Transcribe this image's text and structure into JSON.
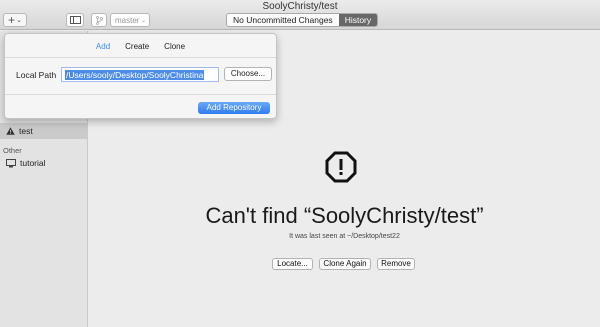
{
  "window": {
    "title": "SoolyChristy/test"
  },
  "toolbar": {
    "add_label": "+",
    "add_chevron": "⌄",
    "branch_label": "master",
    "branch_chevron": "⌄",
    "segments": [
      {
        "label": "No Uncommitted Changes",
        "active": false
      },
      {
        "label": "History",
        "active": true
      }
    ]
  },
  "popover": {
    "tabs": [
      {
        "label": "Add",
        "active": true
      },
      {
        "label": "Create",
        "active": false
      },
      {
        "label": "Clone",
        "active": false
      }
    ],
    "local_path_label": "Local Path",
    "local_path_value": "/Users/sooly/Desktop/SoolyChristina",
    "choose_label": "Choose...",
    "add_repository_label": "Add Repository"
  },
  "sidebar": {
    "selected_repo": "test",
    "other_header": "Other",
    "other_items": [
      "tutorial"
    ]
  },
  "main": {
    "title": "Can't find “SoolyChristy/test”",
    "subtitle": "It was last seen at ~/Desktop/test22",
    "buttons": {
      "locate": "Locate...",
      "clone_again": "Clone Again",
      "remove": "Remove"
    }
  },
  "colors": {
    "accent": "#3b8ef3",
    "selected_segment": "#676767",
    "primary_button": "#2f7cf0"
  }
}
